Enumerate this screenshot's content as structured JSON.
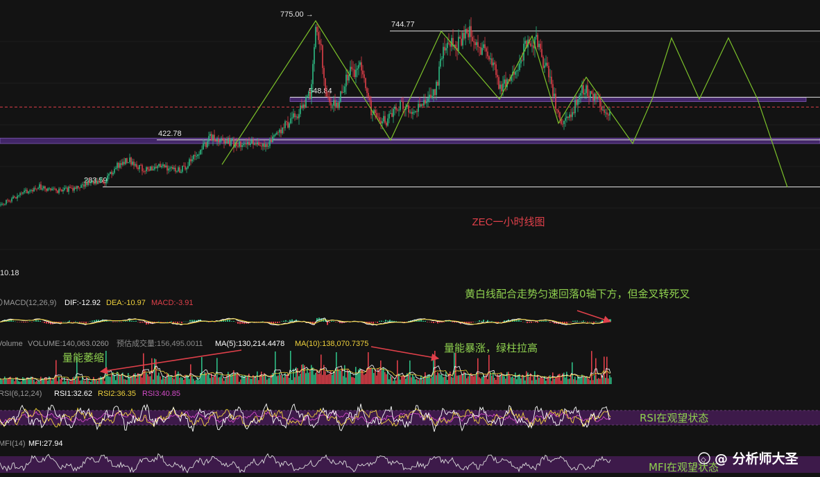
{
  "chart_data": {
    "type": "candlestick",
    "title": "ZEC一小时线图",
    "main": {
      "y_range": [
        0,
        820
      ],
      "levels": [
        {
          "id": "high_775",
          "label": "775.00 →",
          "value": 775.0
        },
        {
          "id": "high_744",
          "label": "744.77",
          "value": 744.77
        },
        {
          "id": "mid_548",
          "label": "548.84",
          "value": 548.84
        },
        {
          "id": "mid_422",
          "label": "422.78",
          "value": 422.78
        },
        {
          "id": "low_283",
          "label": "283.59",
          "value": 283.59
        },
        {
          "id": "start_10",
          "label": "10.18",
          "value": 10.18
        }
      ],
      "zones": [
        {
          "id": "zone_upper",
          "from": 536,
          "to": 548
        },
        {
          "id": "zone_lower",
          "from": 412,
          "to": 428
        }
      ],
      "close_price_approx": 520,
      "price_path": [
        [
          0,
          230
        ],
        [
          30,
          262
        ],
        [
          55,
          285
        ],
        [
          80,
          272
        ],
        [
          105,
          278
        ],
        [
          130,
          298
        ],
        [
          150,
          300
        ],
        [
          165,
          340
        ],
        [
          185,
          365
        ],
        [
          210,
          332
        ],
        [
          235,
          345
        ],
        [
          260,
          330
        ],
        [
          285,
          385
        ],
        [
          305,
          432
        ],
        [
          325,
          418
        ],
        [
          350,
          405
        ],
        [
          370,
          418
        ],
        [
          390,
          412
        ],
        [
          410,
          462
        ],
        [
          430,
          505
        ],
        [
          447,
          560
        ],
        [
          455,
          750
        ],
        [
          462,
          700
        ],
        [
          470,
          545
        ],
        [
          485,
          520
        ],
        [
          500,
          610
        ],
        [
          518,
          640
        ],
        [
          535,
          510
        ],
        [
          555,
          475
        ],
        [
          575,
          525
        ],
        [
          595,
          510
        ],
        [
          612,
          535
        ],
        [
          628,
          565
        ],
        [
          640,
          695
        ],
        [
          660,
          705
        ],
        [
          678,
          745
        ],
        [
          690,
          690
        ],
        [
          705,
          680
        ],
        [
          720,
          580
        ],
        [
          740,
          615
        ],
        [
          758,
          700
        ],
        [
          772,
          720
        ],
        [
          790,
          615
        ],
        [
          808,
          470
        ],
        [
          825,
          505
        ],
        [
          840,
          575
        ],
        [
          858,
          545
        ],
        [
          870,
          505
        ],
        [
          880,
          495
        ]
      ],
      "forecast_path": [
        [
          320,
          350
        ],
        [
          455,
          775
        ],
        [
          563,
          422
        ],
        [
          636,
          744
        ],
        [
          720,
          543
        ],
        [
          767,
          730
        ],
        [
          805,
          472
        ],
        [
          845,
          608
        ],
        [
          875,
          520
        ],
        [
          912,
          412
        ],
        [
          940,
          543
        ],
        [
          968,
          724
        ],
        [
          1008,
          543
        ],
        [
          1050,
          724
        ],
        [
          1092,
          543
        ],
        [
          1135,
          283
        ]
      ]
    },
    "macd": {
      "params": "MACD(12,26,9)",
      "dif_label": "DIF:-12.92",
      "dea_label": "DEA:-10.97",
      "macd_label": "MACD:-3.91",
      "dif": -12.92,
      "dea": -10.97,
      "macd": -3.91
    },
    "volume": {
      "label": "Volume",
      "volume_label": "VOLUME:140,063.0260",
      "est_label": "预估成交量:156,495.0011",
      "ma5_label": "MA(5):130,214.4478",
      "ma10_label": "MA(10):138,070.7375",
      "volume": 140063.026,
      "estimated": 156495.0011,
      "ma5": 130214.4478,
      "ma10": 138070.7375
    },
    "rsi": {
      "params": "RSI(6,12,24)",
      "rsi1_label": "RSI1:32.62",
      "rsi2_label": "RSI2:36.35",
      "rsi3_label": "RSI3:40.85",
      "rsi1": 32.62,
      "rsi2": 36.35,
      "rsi3": 40.85
    },
    "mfi": {
      "params": "MFI(14)",
      "mfi_label": "MFI:27.94",
      "mfi": 27.94
    },
    "annotations": {
      "macd_note": "黄白线配合走势匀速回落0轴下方，但金叉转死叉",
      "volume_note_left": "量能萎缩",
      "volume_note_right": "量能暴涨，绿柱拉高",
      "rsi_note": "RSI在观望状态",
      "mfi_note": "MFI在观望状态"
    },
    "watermark": "分析师大圣",
    "colors": {
      "background": "#131313",
      "up": "#2ebd85",
      "down": "#e0404a",
      "dif_line": "#ffffff",
      "dea_line": "#f0d23c",
      "zone_fill": "#4b2a78",
      "forecast_line": "#7cc22a",
      "annotation_green": "#8fd14f",
      "annotation_red": "#e0404a",
      "purple_band": "#3d1a4a",
      "rsi3_color": "#d24bc8"
    }
  }
}
